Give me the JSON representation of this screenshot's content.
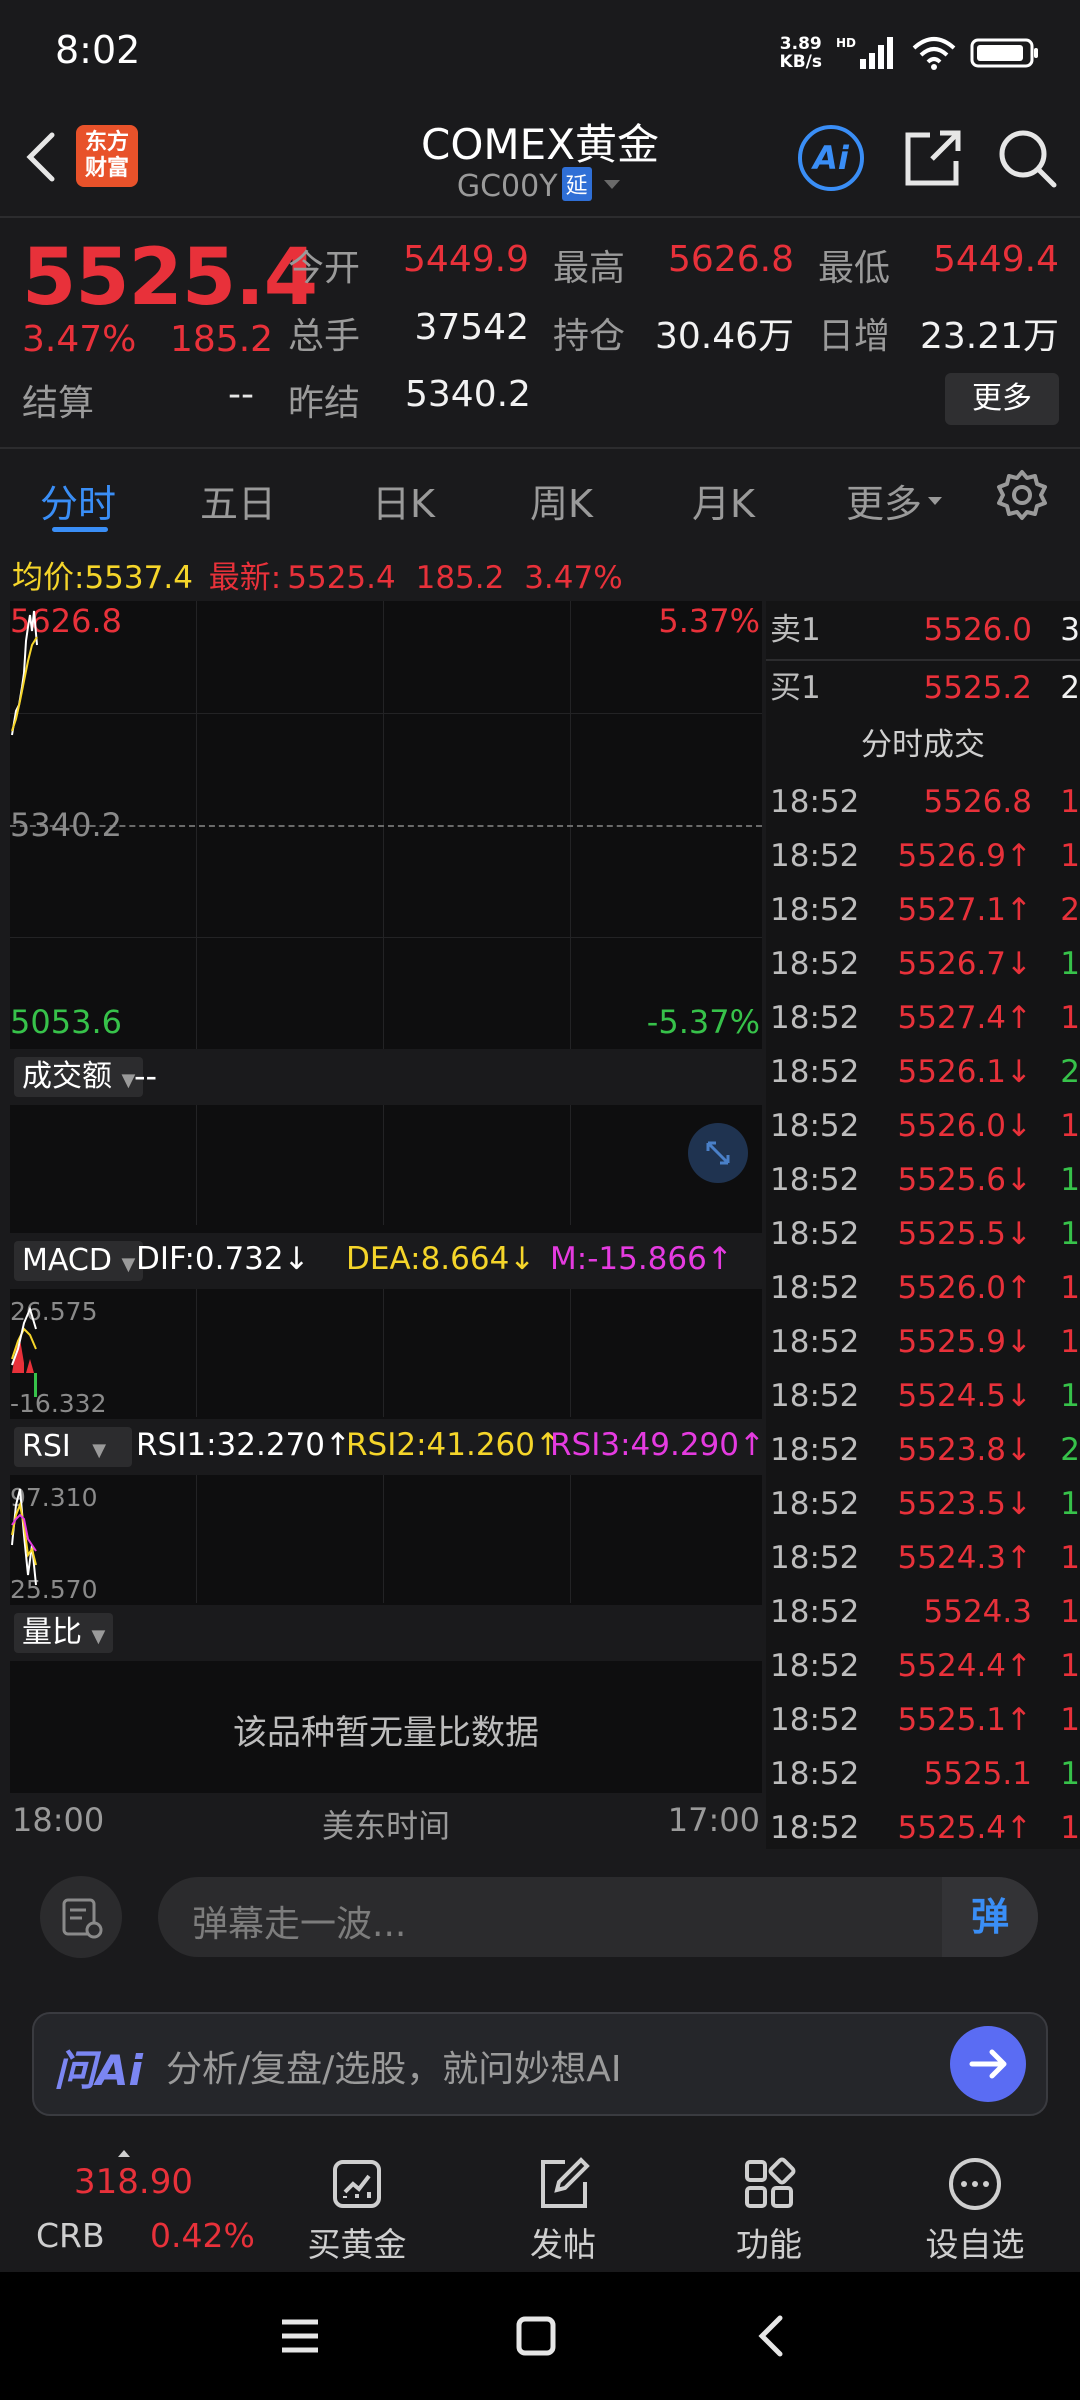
{
  "status": {
    "time": "8:02",
    "net_speed_top": "3.89",
    "net_speed_bottom": "KB/s",
    "hd": "HD"
  },
  "header": {
    "title": "COMEX黄金",
    "code": "GC00Y",
    "delay_badge": "延",
    "logo_line1": "东方",
    "logo_line2": "财富",
    "ai_label": "Ai"
  },
  "quote": {
    "price": "5525.4",
    "change_pct": "3.47%",
    "change_abs": "185.2",
    "open_label": "今开",
    "open": "5449.9",
    "high_label": "最高",
    "high": "5626.8",
    "low_label": "最低",
    "low": "5449.4",
    "volume_label": "总手",
    "volume": "37542",
    "oi_label": "持仓",
    "oi": "30.46万",
    "daily_inc_label": "日增",
    "daily_inc": "23.21万",
    "settle_label": "结算",
    "settle": "--",
    "prev_settle_label": "昨结",
    "prev_settle": "5340.2",
    "more_label": "更多"
  },
  "tabs": [
    "分时",
    "五日",
    "日K",
    "周K",
    "月K",
    "更多"
  ],
  "avg_line": {
    "avg_label": "均价:",
    "avg": "5537.4",
    "latest_label": "最新:",
    "latest": "5525.4",
    "chg": "185.2",
    "pct": "3.47%"
  },
  "chart": {
    "max_price": "5626.8",
    "max_pct": "5.37%",
    "mid_price": "5340.2",
    "min_price": "5053.6",
    "min_pct": "-5.37%",
    "amount_label": "成交额",
    "amount_value": "--",
    "macd_label": "MACD",
    "dif": "DIF:0.732↓",
    "dea": "DEA:8.664↓",
    "m": "M:-15.866↑",
    "macd_max": "26.575",
    "macd_min": "-16.332",
    "rsi_label": "RSI",
    "rsi1": "RSI1:32.270↑",
    "rsi2": "RSI2:41.260↑",
    "rsi3": "RSI3:49.290↑",
    "rsi_max": "97.310",
    "rsi_min": "25.570",
    "volratio_label": "量比",
    "volratio_empty": "该品种暂无量比数据",
    "time_start": "18:00",
    "time_mid": "美东时间",
    "time_end": "17:00"
  },
  "orderbook": {
    "sell_label": "卖1",
    "sell_price": "5526.0",
    "sell_vol": "3",
    "buy_label": "买1",
    "buy_price": "5525.2",
    "buy_vol": "2",
    "trades_title": "分时成交",
    "trades": [
      {
        "t": "18:52",
        "p": "5526.8",
        "v": "1",
        "pc": "red",
        "vc": "red"
      },
      {
        "t": "18:52",
        "p": "5526.9↑",
        "v": "1",
        "pc": "red",
        "vc": "red"
      },
      {
        "t": "18:52",
        "p": "5527.1↑",
        "v": "2",
        "pc": "red",
        "vc": "red"
      },
      {
        "t": "18:52",
        "p": "5526.7↓",
        "v": "1",
        "pc": "red",
        "vc": "green"
      },
      {
        "t": "18:52",
        "p": "5527.4↑",
        "v": "1",
        "pc": "red",
        "vc": "red"
      },
      {
        "t": "18:52",
        "p": "5526.1↓",
        "v": "2",
        "pc": "red",
        "vc": "green"
      },
      {
        "t": "18:52",
        "p": "5526.0↓",
        "v": "1",
        "pc": "red",
        "vc": "red"
      },
      {
        "t": "18:52",
        "p": "5525.6↓",
        "v": "1",
        "pc": "red",
        "vc": "green"
      },
      {
        "t": "18:52",
        "p": "5525.5↓",
        "v": "1",
        "pc": "red",
        "vc": "green"
      },
      {
        "t": "18:52",
        "p": "5526.0↑",
        "v": "1",
        "pc": "red",
        "vc": "red"
      },
      {
        "t": "18:52",
        "p": "5525.9↓",
        "v": "1",
        "pc": "red",
        "vc": "red"
      },
      {
        "t": "18:52",
        "p": "5524.5↓",
        "v": "1",
        "pc": "red",
        "vc": "green"
      },
      {
        "t": "18:52",
        "p": "5523.8↓",
        "v": "2",
        "pc": "red",
        "vc": "green"
      },
      {
        "t": "18:52",
        "p": "5523.5↓",
        "v": "1",
        "pc": "red",
        "vc": "green"
      },
      {
        "t": "18:52",
        "p": "5524.3↑",
        "v": "1",
        "pc": "red",
        "vc": "red"
      },
      {
        "t": "18:52",
        "p": "5524.3",
        "v": "1",
        "pc": "red",
        "vc": "red"
      },
      {
        "t": "18:52",
        "p": "5524.4↑",
        "v": "1",
        "pc": "red",
        "vc": "red"
      },
      {
        "t": "18:52",
        "p": "5525.1↑",
        "v": "1",
        "pc": "red",
        "vc": "red"
      },
      {
        "t": "18:52",
        "p": "5525.1",
        "v": "1",
        "pc": "red",
        "vc": "green"
      },
      {
        "t": "18:52",
        "p": "5525.4↑",
        "v": "1",
        "pc": "red",
        "vc": "red"
      }
    ]
  },
  "danmu": {
    "placeholder": "弹幕走一波...",
    "button": "弹"
  },
  "ai_bar": {
    "logo": "问Ai",
    "placeholder": "分析/复盘/选股，就问妙想AI"
  },
  "bottom_nav": {
    "crb_value": "318.90",
    "crb_label": "CRB",
    "crb_pct": "0.42%",
    "items": [
      {
        "label": "买黄金",
        "icon": "chart-icon"
      },
      {
        "label": "发帖",
        "icon": "edit-icon"
      },
      {
        "label": "功能",
        "icon": "grid-icon"
      },
      {
        "label": "设自选",
        "icon": "more-icon"
      }
    ]
  },
  "colors": {
    "red": "#e8313a",
    "green": "#37c24a",
    "accent": "#3a8ef6",
    "yellow": "#f5d52a",
    "magenta": "#e53be0"
  }
}
